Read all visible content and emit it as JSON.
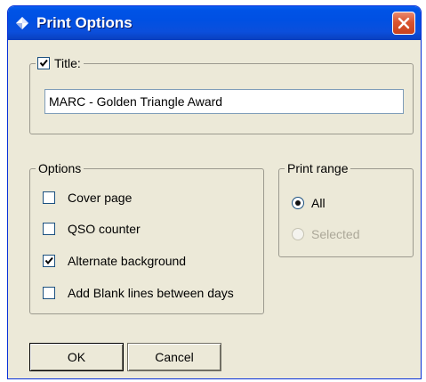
{
  "window": {
    "title": "Print Options"
  },
  "title_group": {
    "checkbox_label": "Title:",
    "checked": true,
    "title_value": "MARC - Golden Triangle Award"
  },
  "options_group": {
    "legend": "Options",
    "items": [
      {
        "label": "Cover page",
        "checked": false
      },
      {
        "label": "QSO counter",
        "checked": false
      },
      {
        "label": "Alternate background",
        "checked": true
      },
      {
        "label": "Add Blank lines between days",
        "checked": false
      }
    ]
  },
  "print_range_group": {
    "legend": "Print range",
    "options": [
      {
        "label": "All",
        "selected": true,
        "enabled": true
      },
      {
        "label": "Selected",
        "selected": false,
        "enabled": false
      }
    ]
  },
  "buttons": {
    "ok_label": "OK",
    "cancel_label": "Cancel"
  },
  "colors": {
    "titlebar": "#0053e6",
    "dialog_bg": "#ece9d8",
    "close_button": "#d9542f"
  },
  "icons": {
    "title_icon": "diamond-icon",
    "close_icon": "close-icon",
    "check_icon": "checkmark-icon"
  }
}
